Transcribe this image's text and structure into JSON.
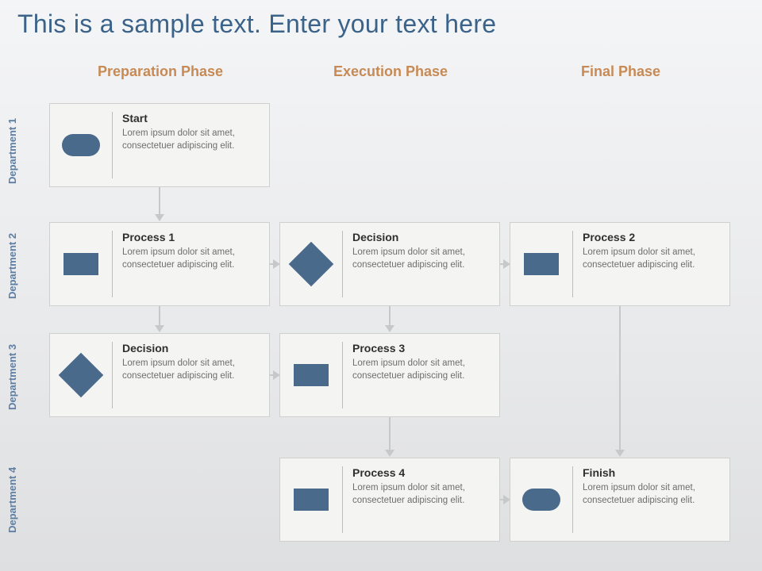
{
  "title": "This is a sample text. Enter your text here",
  "phases": {
    "p1": "Preparation Phase",
    "p2": "Execution Phase",
    "p3": "Final Phase"
  },
  "depts": {
    "d1": "Department 1",
    "d2": "Department 2",
    "d3": "Department 3",
    "d4": "Department 4"
  },
  "lorem": "Lorem ipsum dolor sit amet, consectetuer adipiscing elit.",
  "cards": {
    "start": {
      "title": "Start",
      "shape": "terminator"
    },
    "p1": {
      "title": "Process 1",
      "shape": "process"
    },
    "dec1": {
      "title": "Decision",
      "shape": "decision"
    },
    "dec2": {
      "title": "Decision",
      "shape": "decision"
    },
    "p3": {
      "title": "Process 3",
      "shape": "process"
    },
    "p4": {
      "title": "Process 4",
      "shape": "process"
    },
    "p2": {
      "title": "Process 2",
      "shape": "process"
    },
    "finish": {
      "title": "Finish",
      "shape": "terminator"
    }
  },
  "colors": {
    "accent": "#4a6a8c",
    "phase": "#c78a54",
    "title": "#3b6389"
  },
  "chart_data": {
    "type": "table",
    "title": "Swimlane flowchart",
    "columns": [
      "Preparation Phase",
      "Execution Phase",
      "Final Phase"
    ],
    "rows": [
      "Department 1",
      "Department 2",
      "Department 3",
      "Department 4"
    ],
    "nodes": [
      {
        "id": "start",
        "label": "Start",
        "shape": "terminator",
        "row": "Department 1",
        "col": "Preparation Phase"
      },
      {
        "id": "p1",
        "label": "Process 1",
        "shape": "process",
        "row": "Department 2",
        "col": "Preparation Phase"
      },
      {
        "id": "dec2",
        "label": "Decision",
        "shape": "decision",
        "row": "Department 2",
        "col": "Execution Phase"
      },
      {
        "id": "p2",
        "label": "Process 2",
        "shape": "process",
        "row": "Department 2",
        "col": "Final Phase"
      },
      {
        "id": "dec1",
        "label": "Decision",
        "shape": "decision",
        "row": "Department 3",
        "col": "Preparation Phase"
      },
      {
        "id": "p3",
        "label": "Process 3",
        "shape": "process",
        "row": "Department 3",
        "col": "Execution Phase"
      },
      {
        "id": "p4",
        "label": "Process 4",
        "shape": "process",
        "row": "Department 4",
        "col": "Execution Phase"
      },
      {
        "id": "finish",
        "label": "Finish",
        "shape": "terminator",
        "row": "Department 4",
        "col": "Final Phase"
      }
    ],
    "edges": [
      [
        "start",
        "p1"
      ],
      [
        "p1",
        "dec1"
      ],
      [
        "p1",
        "dec2"
      ],
      [
        "dec2",
        "p2"
      ],
      [
        "dec2",
        "p3"
      ],
      [
        "dec1",
        "p3"
      ],
      [
        "p3",
        "p4"
      ],
      [
        "p4",
        "finish"
      ],
      [
        "p2",
        "finish"
      ]
    ]
  }
}
